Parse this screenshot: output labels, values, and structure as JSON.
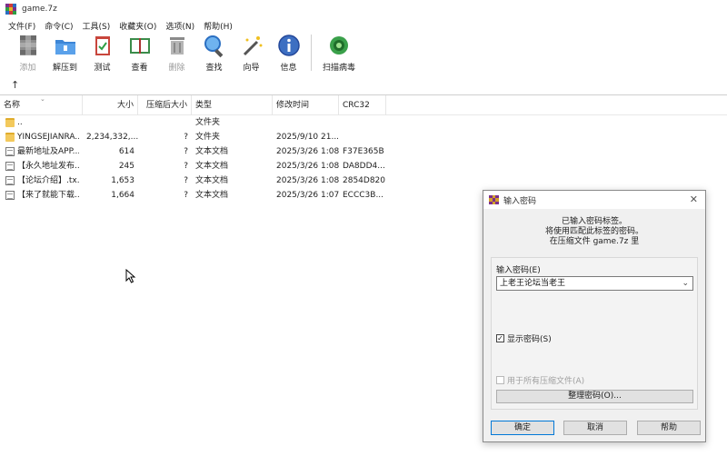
{
  "window": {
    "title": "game.7z"
  },
  "menu": [
    "文件(F)",
    "命令(C)",
    "工具(S)",
    "收藏夹(O)",
    "选项(N)",
    "帮助(H)"
  ],
  "toolbar": {
    "add": "添加",
    "extract": "解压到",
    "test": "测试",
    "view": "查看",
    "delete": "删除",
    "find": "查找",
    "wizard": "向导",
    "info": "信息",
    "scan": "扫描病毒"
  },
  "columns": {
    "name": "名称",
    "size": "大小",
    "packed": "压缩后大小",
    "type": "类型",
    "modified": "修改时间",
    "crc": "CRC32"
  },
  "files": [
    {
      "name": "..",
      "size": "",
      "packed": "",
      "type": "文件夹",
      "modified": "",
      "crc": "",
      "icon": "folder"
    },
    {
      "name": "YINGSEJIANRA...",
      "size": "2,234,332,...",
      "packed": "?",
      "type": "文件夹",
      "modified": "2025/9/10 21...",
      "crc": "",
      "icon": "folder"
    },
    {
      "name": "最新地址及APP...",
      "size": "614",
      "packed": "?",
      "type": "文本文档",
      "modified": "2025/3/26 1:08",
      "crc": "F37E365B",
      "icon": "doc"
    },
    {
      "name": "【永久地址发布...",
      "size": "245",
      "packed": "?",
      "type": "文本文档",
      "modified": "2025/3/26 1:08",
      "crc": "DA8DD4...",
      "icon": "doc"
    },
    {
      "name": "【论坛介绍】.tx...",
      "size": "1,653",
      "packed": "?",
      "type": "文本文档",
      "modified": "2025/3/26 1:08",
      "crc": "2854D820",
      "icon": "doc"
    },
    {
      "name": "【来了就能下载...",
      "size": "1,664",
      "packed": "?",
      "type": "文本文档",
      "modified": "2025/3/26 1:07",
      "crc": "ECCC3B...",
      "icon": "doc"
    }
  ],
  "dialog": {
    "title": "输入密码",
    "info_line1": "已输入密码标签。",
    "info_line2": "将使用匹配此标签的密码。",
    "info_line3": "在压缩文件 game.7z 里",
    "password_label": "输入密码(E)",
    "password_value": "上老王论坛当老王",
    "show_password": "显示密码(S)",
    "show_password_checked": true,
    "use_for_all": "用于所有压缩文件(A)",
    "use_for_all_checked": false,
    "manage_button": "整理密码(O)...",
    "ok": "确定",
    "cancel": "取消",
    "help": "帮助"
  },
  "colors": {
    "accent": "#0078d7",
    "folder": "#f3c95c"
  }
}
